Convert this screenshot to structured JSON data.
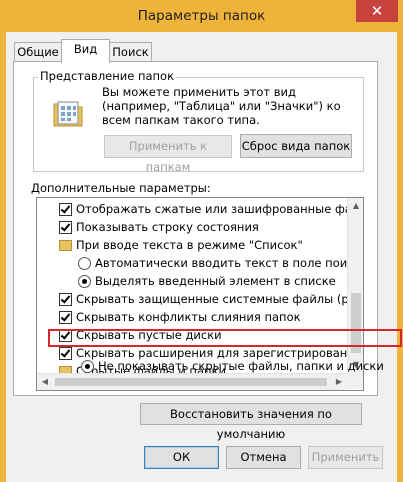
{
  "window": {
    "title": "Параметры папок",
    "close_glyph": "✕"
  },
  "tabs": [
    {
      "label": "Общие"
    },
    {
      "label": "Вид"
    },
    {
      "label": "Поиск"
    }
  ],
  "folder_view": {
    "group_title": "Представление папок",
    "description": "Вы можете применить этот вид (например, \"Таблица\" или \"Значки\") ко всем папкам такого типа.",
    "apply_button": "Применить к папкам",
    "reset_button": "Сброс вида папок"
  },
  "advanced": {
    "label": "Дополнительные параметры:",
    "items": [
      {
        "kind": "checkbox",
        "checked": true,
        "text": "Отображать сжатые или зашифрованные файлы NTFS"
      },
      {
        "kind": "checkbox",
        "checked": true,
        "text": "Показывать строку состояния"
      },
      {
        "kind": "folder",
        "text": "При вводе текста в режиме \"Список\""
      },
      {
        "kind": "radio",
        "selected": false,
        "text": "Автоматически вводить текст в поле поиска"
      },
      {
        "kind": "radio",
        "selected": true,
        "text": "Выделять введенный элемент в списке"
      },
      {
        "kind": "checkbox",
        "checked": true,
        "text": "Скрывать защищенные системные файлы (рекомендуется)"
      },
      {
        "kind": "checkbox",
        "checked": true,
        "text": "Скрывать конфликты слияния папок"
      },
      {
        "kind": "checkbox",
        "checked": true,
        "text": "Скрывать пустые диски"
      },
      {
        "kind": "checkbox",
        "checked": true,
        "text": "Скрывать расширения для зарегистрированных типов файлов"
      },
      {
        "kind": "folder",
        "text": "Скрытые файлы и папки"
      },
      {
        "kind": "radio",
        "selected": true,
        "text": "Не показывать скрытые файлы, папки и диски"
      }
    ],
    "restore_button": "Восстановить значения по умолчанию"
  },
  "footer": {
    "ok": "ОК",
    "cancel": "Отмена",
    "apply": "Применить"
  },
  "colors": {
    "frame": "#f0b33a",
    "close": "#c7423d",
    "highlight": "#d9262b"
  }
}
